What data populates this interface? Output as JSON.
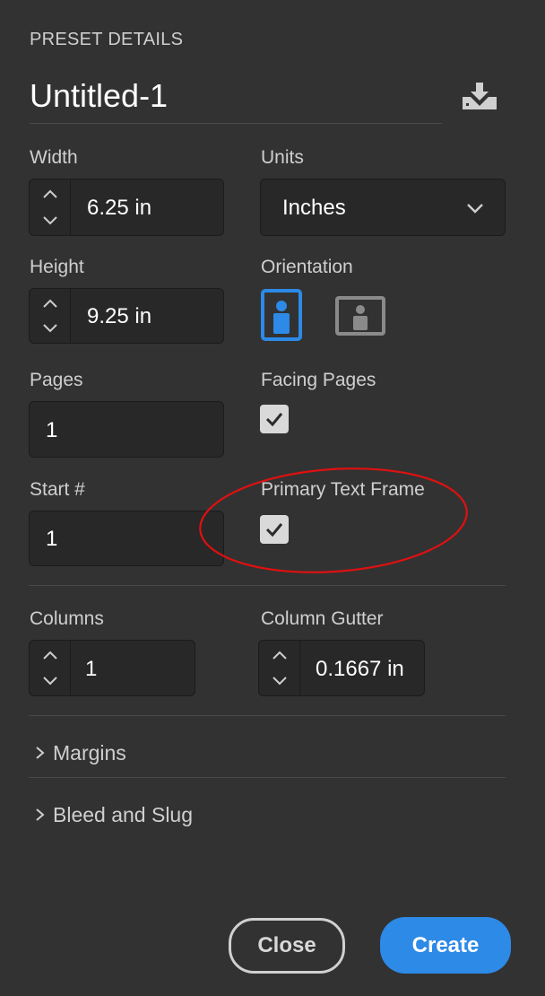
{
  "panel": {
    "section_title": "PRESET DETAILS",
    "document_name": "Untitled-1",
    "save_preset_icon": "download-tray-icon"
  },
  "fields": {
    "width": {
      "label": "Width",
      "value": "6.25 in"
    },
    "units": {
      "label": "Units",
      "value": "Inches"
    },
    "height": {
      "label": "Height",
      "value": "9.25 in"
    },
    "orientation": {
      "label": "Orientation",
      "selected": "portrait",
      "options": [
        "portrait",
        "landscape"
      ]
    },
    "pages": {
      "label": "Pages",
      "value": "1"
    },
    "facing_pages": {
      "label": "Facing Pages",
      "checked": true
    },
    "start_number": {
      "label": "Start #",
      "value": "1"
    },
    "primary_text_frame": {
      "label": "Primary Text Frame",
      "checked": true
    },
    "columns": {
      "label": "Columns",
      "value": "1"
    },
    "column_gutter": {
      "label": "Column Gutter",
      "value": "0.1667 in"
    }
  },
  "sections": {
    "margins": "Margins",
    "bleed_and_slug": "Bleed and Slug"
  },
  "buttons": {
    "close": "Close",
    "create": "Create"
  },
  "colors": {
    "background": "#323232",
    "accent": "#2d8ae6",
    "annotation": "#e01010"
  }
}
